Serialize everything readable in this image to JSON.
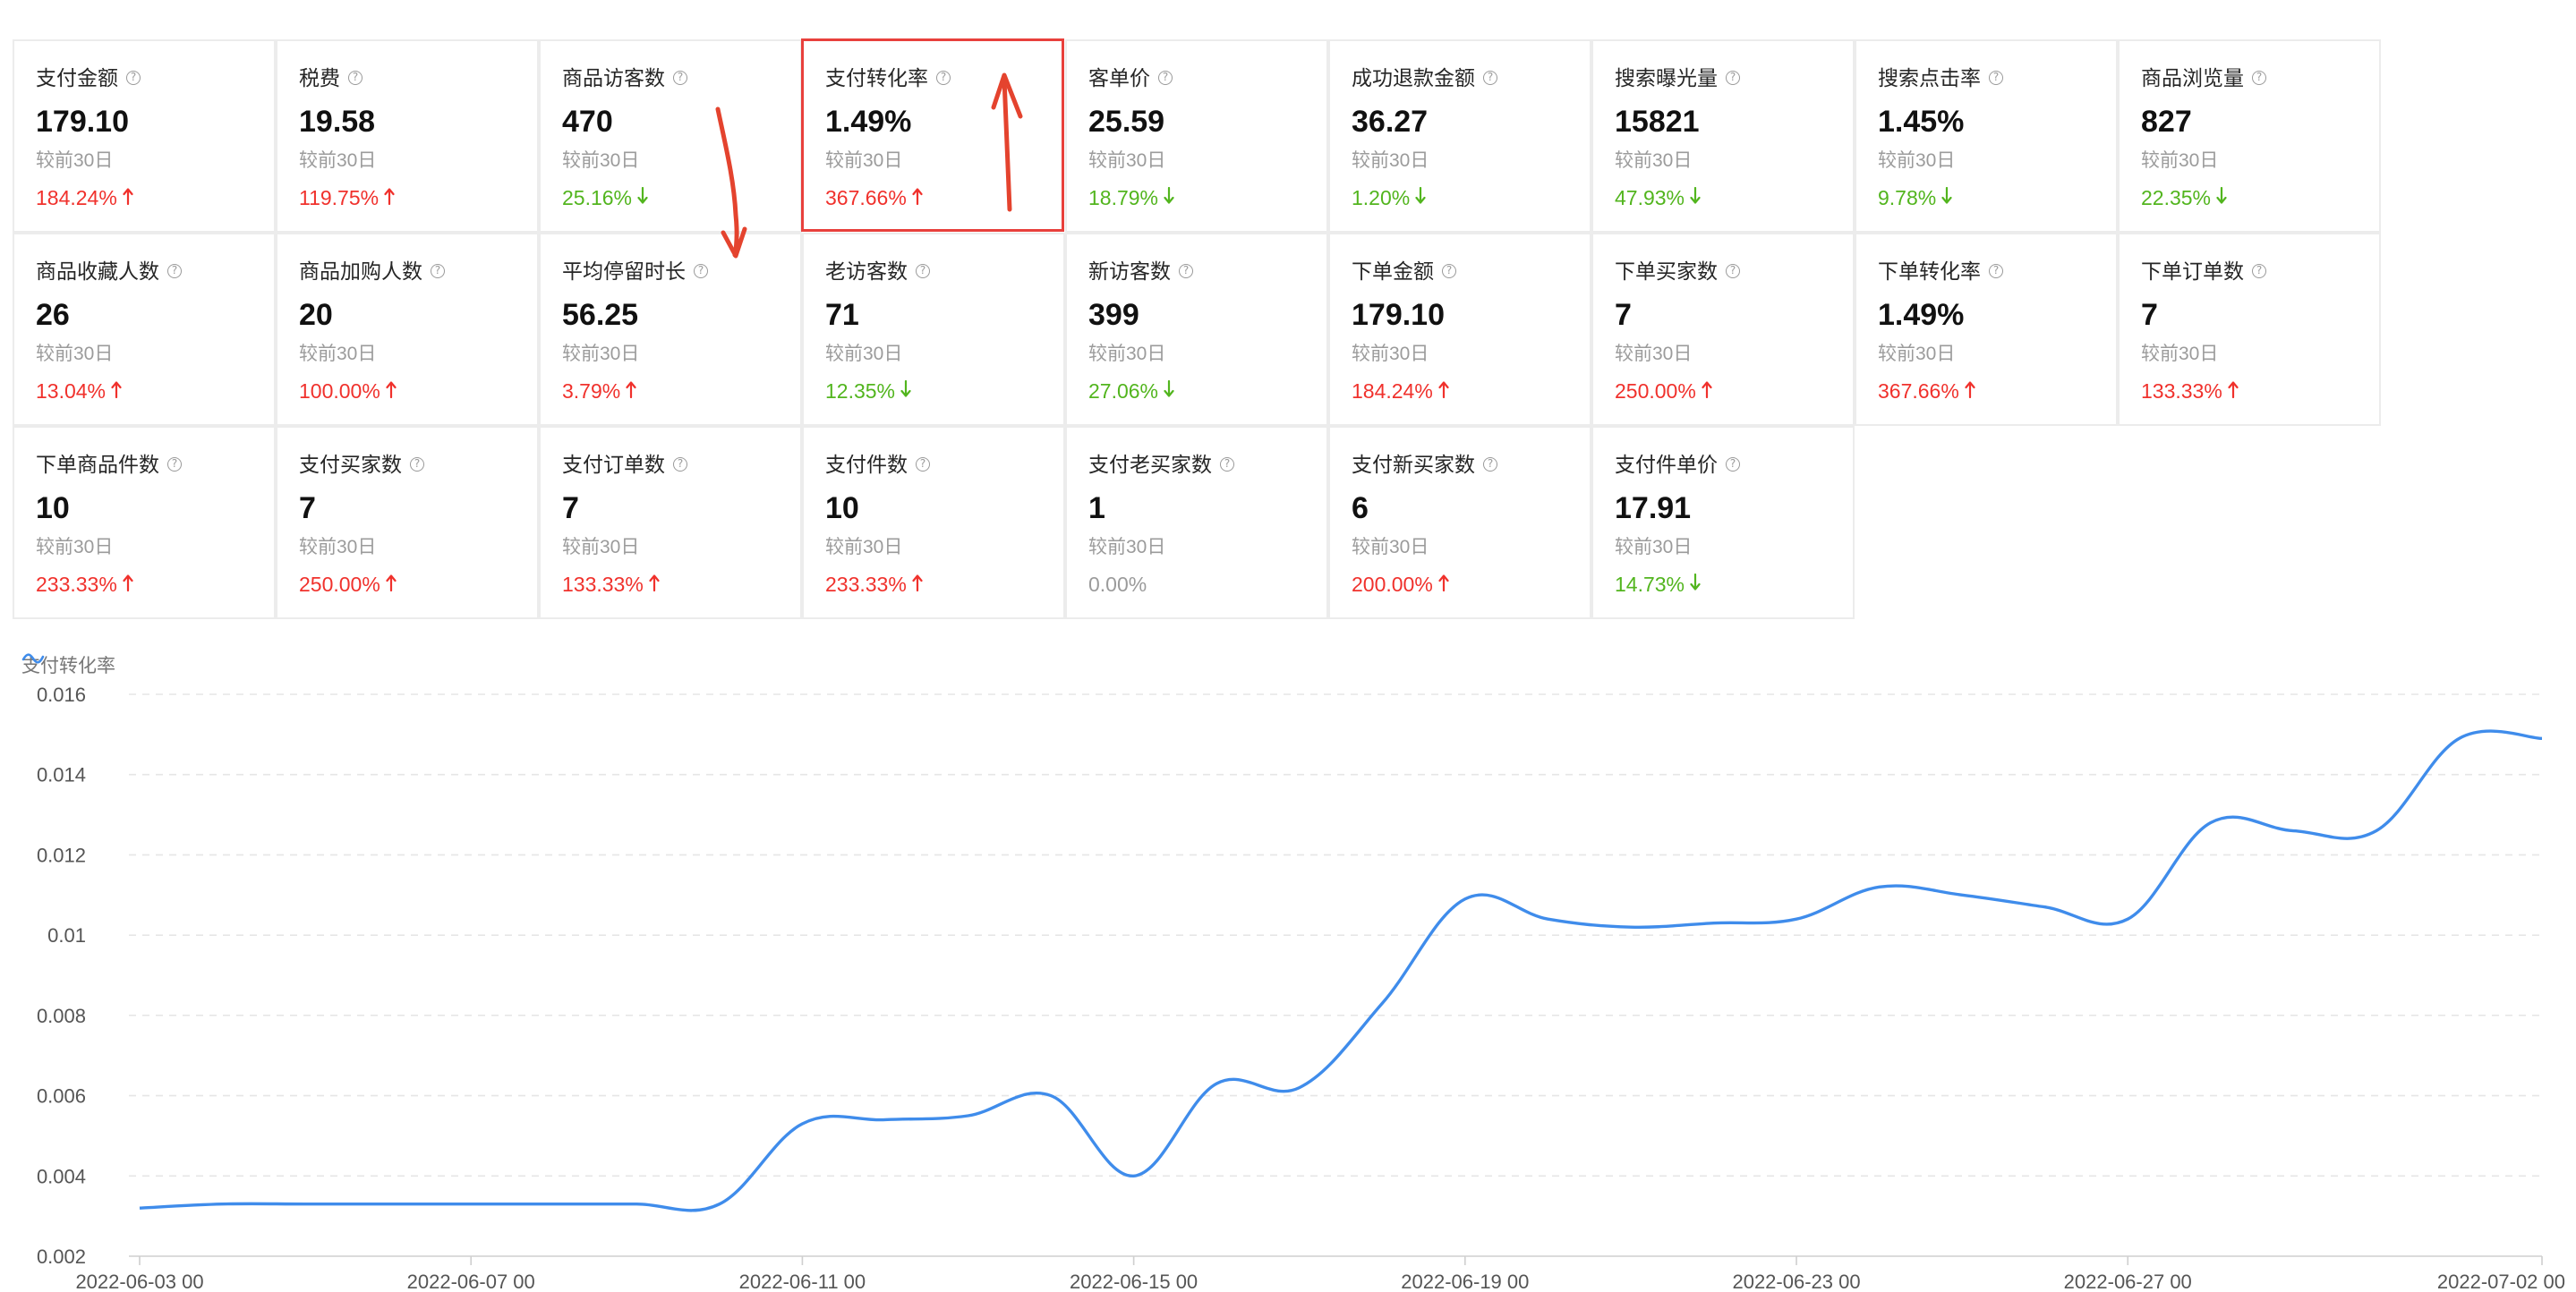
{
  "cards": [
    {
      "title": "支付金额",
      "value": "179.10",
      "compare": "较前30日",
      "change": "184.24%",
      "dir": "up"
    },
    {
      "title": "税费",
      "value": "19.58",
      "compare": "较前30日",
      "change": "119.75%",
      "dir": "up"
    },
    {
      "title": "商品访客数",
      "value": "470",
      "compare": "较前30日",
      "change": "25.16%",
      "dir": "down"
    },
    {
      "title": "支付转化率",
      "value": "1.49%",
      "compare": "较前30日",
      "change": "367.66%",
      "dir": "up",
      "highlight": true
    },
    {
      "title": "客单价",
      "value": "25.59",
      "compare": "较前30日",
      "change": "18.79%",
      "dir": "down"
    },
    {
      "title": "成功退款金额",
      "value": "36.27",
      "compare": "较前30日",
      "change": "1.20%",
      "dir": "down"
    },
    {
      "title": "搜索曝光量",
      "value": "15821",
      "compare": "较前30日",
      "change": "47.93%",
      "dir": "down"
    },
    {
      "title": "搜索点击率",
      "value": "1.45%",
      "compare": "较前30日",
      "change": "9.78%",
      "dir": "down"
    },
    {
      "title": "商品浏览量",
      "value": "827",
      "compare": "较前30日",
      "change": "22.35%",
      "dir": "down"
    },
    {
      "title": "商品收藏人数",
      "value": "26",
      "compare": "较前30日",
      "change": "13.04%",
      "dir": "up"
    },
    {
      "title": "商品加购人数",
      "value": "20",
      "compare": "较前30日",
      "change": "100.00%",
      "dir": "up"
    },
    {
      "title": "平均停留时长",
      "value": "56.25",
      "compare": "较前30日",
      "change": "3.79%",
      "dir": "up"
    },
    {
      "title": "老访客数",
      "value": "71",
      "compare": "较前30日",
      "change": "12.35%",
      "dir": "down"
    },
    {
      "title": "新访客数",
      "value": "399",
      "compare": "较前30日",
      "change": "27.06%",
      "dir": "down"
    },
    {
      "title": "下单金额",
      "value": "179.10",
      "compare": "较前30日",
      "change": "184.24%",
      "dir": "up"
    },
    {
      "title": "下单买家数",
      "value": "7",
      "compare": "较前30日",
      "change": "250.00%",
      "dir": "up"
    },
    {
      "title": "下单转化率",
      "value": "1.49%",
      "compare": "较前30日",
      "change": "367.66%",
      "dir": "up"
    },
    {
      "title": "下单订单数",
      "value": "7",
      "compare": "较前30日",
      "change": "133.33%",
      "dir": "up"
    },
    {
      "title": "下单商品件数",
      "value": "10",
      "compare": "较前30日",
      "change": "233.33%",
      "dir": "up"
    },
    {
      "title": "支付买家数",
      "value": "7",
      "compare": "较前30日",
      "change": "250.00%",
      "dir": "up"
    },
    {
      "title": "支付订单数",
      "value": "7",
      "compare": "较前30日",
      "change": "133.33%",
      "dir": "up"
    },
    {
      "title": "支付件数",
      "value": "10",
      "compare": "较前30日",
      "change": "233.33%",
      "dir": "up"
    },
    {
      "title": "支付老买家数",
      "value": "1",
      "compare": "较前30日",
      "change": "0.00%",
      "dir": "flat"
    },
    {
      "title": "支付新买家数",
      "value": "6",
      "compare": "较前30日",
      "change": "200.00%",
      "dir": "up"
    },
    {
      "title": "支付件单价",
      "value": "17.91",
      "compare": "较前30日",
      "change": "14.73%",
      "dir": "down"
    }
  ],
  "colors": {
    "up": "#f0312c",
    "down": "#52b51e",
    "flat": "#9b9b9b",
    "line": "#3f8ceb",
    "highlight": "#e8403c",
    "annotation": "#e4432e"
  },
  "icons": {
    "help": "question-circle-icon",
    "legend": "line-series-icon",
    "up": "arrow-up-icon",
    "down": "arrow-down-icon"
  },
  "chart_data": {
    "type": "line",
    "legend": [
      "支付转化率"
    ],
    "legend_position": "top-left",
    "grid": true,
    "ylim": [
      0.002,
      0.016
    ],
    "yticks": [
      "0.002",
      "0.004",
      "0.006",
      "0.008",
      "0.01",
      "0.012",
      "0.014",
      "0.016"
    ],
    "xticks": [
      "2022-06-03 00",
      "2022-06-07 00",
      "2022-06-11 00",
      "2022-06-15 00",
      "2022-06-19 00",
      "2022-06-23 00",
      "2022-06-27 00",
      "2022-07-02 00"
    ],
    "x": [
      "2022-06-03",
      "2022-06-04",
      "2022-06-05",
      "2022-06-06",
      "2022-06-07",
      "2022-06-08",
      "2022-06-09",
      "2022-06-10",
      "2022-06-11",
      "2022-06-12",
      "2022-06-13",
      "2022-06-14",
      "2022-06-15",
      "2022-06-16",
      "2022-06-17",
      "2022-06-18",
      "2022-06-19",
      "2022-06-20",
      "2022-06-21",
      "2022-06-22",
      "2022-06-23",
      "2022-06-24",
      "2022-06-25",
      "2022-06-26",
      "2022-06-27",
      "2022-06-28",
      "2022-06-29",
      "2022-06-30",
      "2022-07-01",
      "2022-07-02"
    ],
    "series": [
      {
        "name": "支付转化率",
        "values": [
          0.0032,
          0.0033,
          0.0033,
          0.0033,
          0.0033,
          0.0033,
          0.0033,
          0.0033,
          0.0053,
          0.0054,
          0.0055,
          0.006,
          0.004,
          0.0063,
          0.0062,
          0.0083,
          0.0109,
          0.0104,
          0.0102,
          0.0103,
          0.0104,
          0.0112,
          0.011,
          0.0107,
          0.0104,
          0.0128,
          0.0126,
          0.0126,
          0.0149,
          0.0149
        ]
      }
    ]
  }
}
